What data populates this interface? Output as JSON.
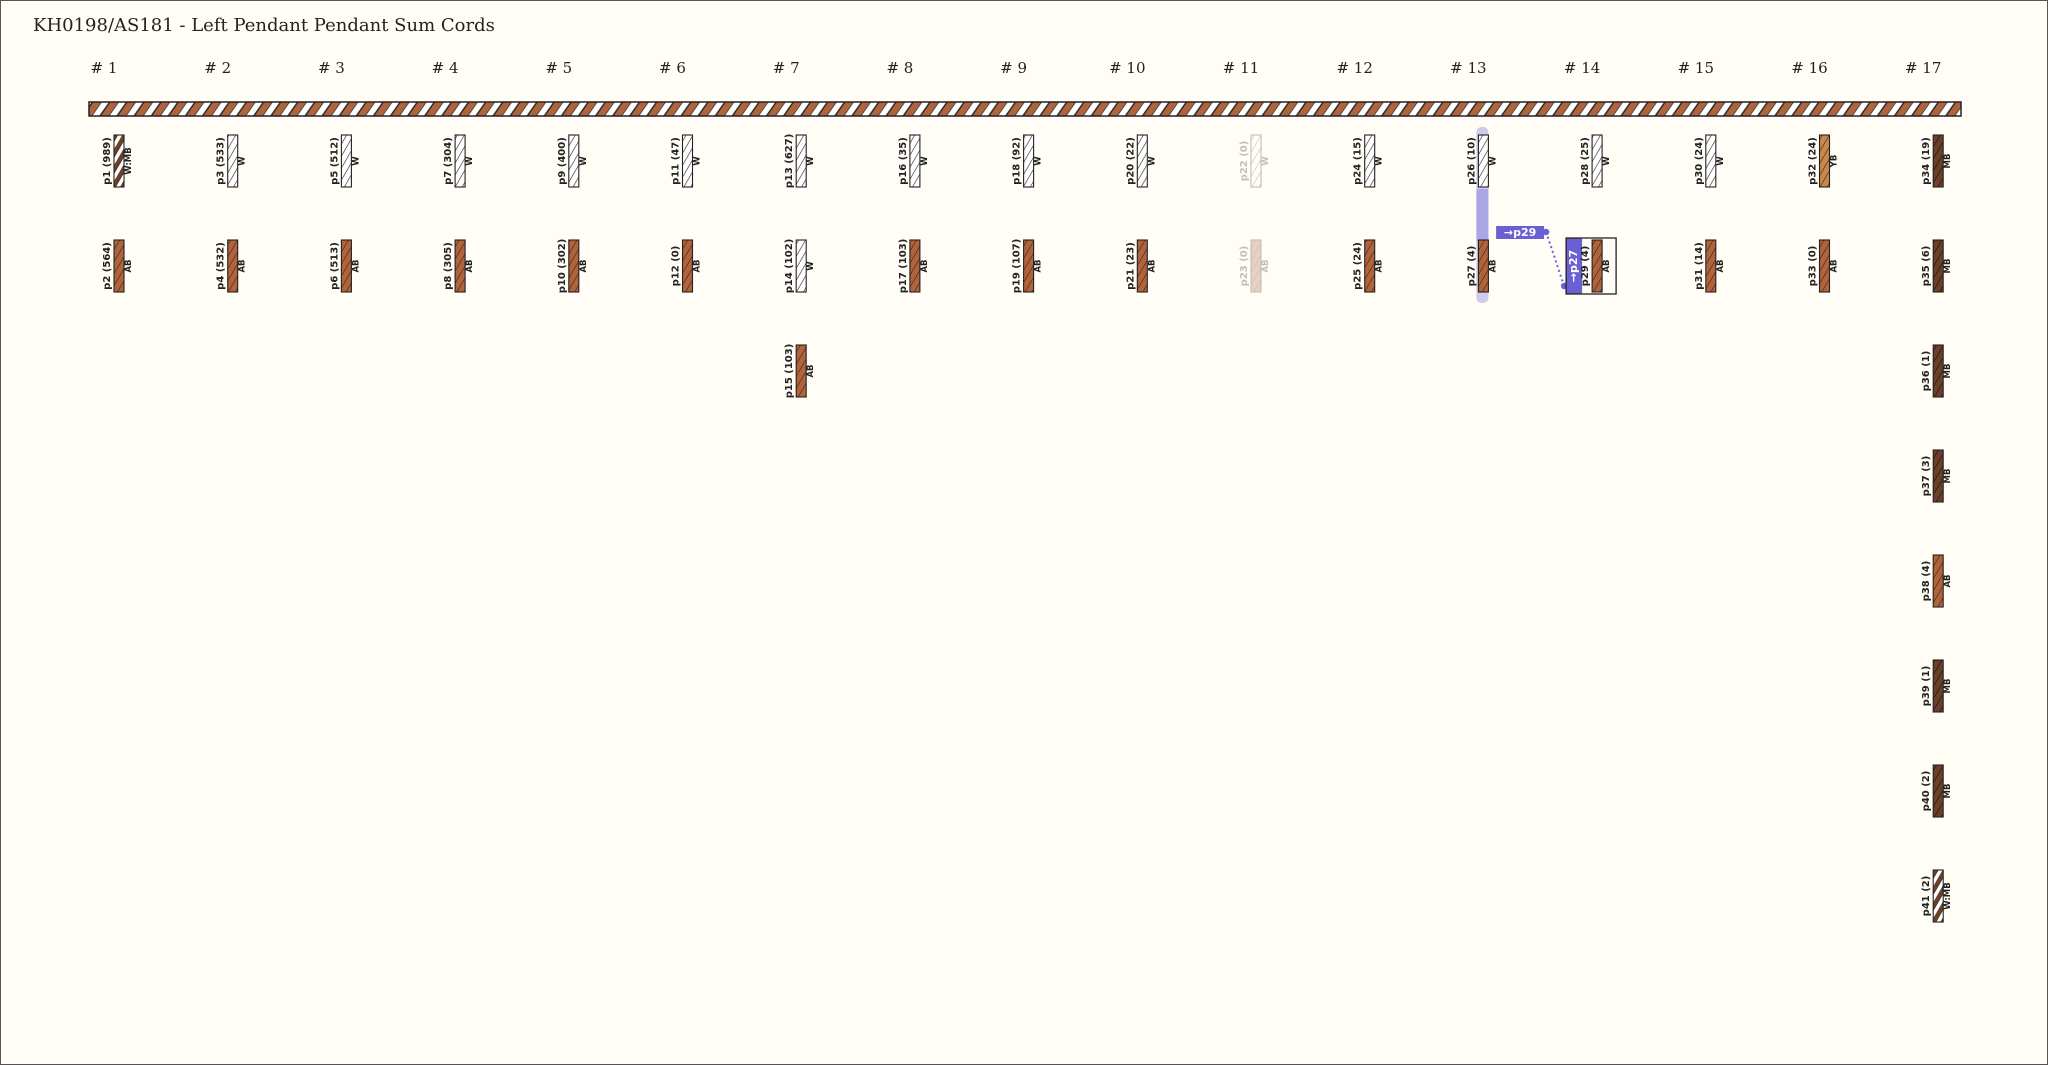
{
  "title": "KH0198/AS181 - Left Pendant Pendant Sum Cords",
  "colors": {
    "W": "#ffffff",
    "AB": "#b0643c",
    "MB": "#6b3f28",
    "YB": "#c88a4c",
    "link": "#6a60d4",
    "link_light": "#bdb9ec",
    "bg": "#fffdf6"
  },
  "groups": [
    "# 1",
    "# 2",
    "# 3",
    "# 4",
    "# 5",
    "# 6",
    "# 7",
    "# 8",
    "# 9",
    "# 10",
    "# 11",
    "# 12",
    "# 13",
    "# 14",
    "# 15",
    "# 16",
    "# 17"
  ],
  "cords": [
    {
      "group": 1,
      "row": 1,
      "label": "p1 (989)",
      "color": "W:MB"
    },
    {
      "group": 1,
      "row": 2,
      "label": "p2 (564)",
      "color": "AB"
    },
    {
      "group": 2,
      "row": 1,
      "label": "p3 (533)",
      "color": "W"
    },
    {
      "group": 2,
      "row": 2,
      "label": "p4 (532)",
      "color": "AB"
    },
    {
      "group": 3,
      "row": 1,
      "label": "p5 (512)",
      "color": "W"
    },
    {
      "group": 3,
      "row": 2,
      "label": "p6 (513)",
      "color": "AB"
    },
    {
      "group": 4,
      "row": 1,
      "label": "p7 (304)",
      "color": "W"
    },
    {
      "group": 4,
      "row": 2,
      "label": "p8 (305)",
      "color": "AB"
    },
    {
      "group": 5,
      "row": 1,
      "label": "p9 (400)",
      "color": "W"
    },
    {
      "group": 5,
      "row": 2,
      "label": "p10 (302)",
      "color": "AB"
    },
    {
      "group": 6,
      "row": 1,
      "label": "p11 (47)",
      "color": "W"
    },
    {
      "group": 6,
      "row": 2,
      "label": "p12 (0)",
      "color": "AB"
    },
    {
      "group": 7,
      "row": 1,
      "label": "p13 (627)",
      "color": "W"
    },
    {
      "group": 7,
      "row": 2,
      "label": "p14 (102)",
      "color": "W"
    },
    {
      "group": 7,
      "row": 3,
      "label": "p15 (103)",
      "color": "AB"
    },
    {
      "group": 8,
      "row": 1,
      "label": "p16 (35)",
      "color": "W"
    },
    {
      "group": 8,
      "row": 2,
      "label": "p17 (103)",
      "color": "AB"
    },
    {
      "group": 9,
      "row": 1,
      "label": "p18 (92)",
      "color": "W"
    },
    {
      "group": 9,
      "row": 2,
      "label": "p19 (107)",
      "color": "AB"
    },
    {
      "group": 10,
      "row": 1,
      "label": "p20 (22)",
      "color": "W"
    },
    {
      "group": 10,
      "row": 2,
      "label": "p21 (23)",
      "color": "AB"
    },
    {
      "group": 11,
      "row": 1,
      "label": "p22 (0)",
      "color": "W",
      "faded": true
    },
    {
      "group": 11,
      "row": 2,
      "label": "p23 (0)",
      "color": "AB",
      "faded": true
    },
    {
      "group": 12,
      "row": 1,
      "label": "p24 (15)",
      "color": "W"
    },
    {
      "group": 12,
      "row": 2,
      "label": "p25 (24)",
      "color": "AB"
    },
    {
      "group": 13,
      "row": 1,
      "label": "p26 (10)",
      "color": "W"
    },
    {
      "group": 13,
      "row": 2,
      "label": "p27 (4)",
      "color": "AB"
    },
    {
      "group": 14,
      "row": 1,
      "label": "p28 (25)",
      "color": "W"
    },
    {
      "group": 14,
      "row": 2,
      "label": "p29 (4)",
      "color": "AB"
    },
    {
      "group": 15,
      "row": 1,
      "label": "p30 (24)",
      "color": "W"
    },
    {
      "group": 15,
      "row": 2,
      "label": "p31 (14)",
      "color": "AB"
    },
    {
      "group": 16,
      "row": 1,
      "label": "p32 (24)",
      "color": "YB"
    },
    {
      "group": 16,
      "row": 2,
      "label": "p33 (0)",
      "color": "AB"
    },
    {
      "group": 17,
      "row": 1,
      "label": "p34 (19)",
      "color": "MB"
    },
    {
      "group": 17,
      "row": 2,
      "label": "p35 (6)",
      "color": "MB"
    },
    {
      "group": 17,
      "row": 3,
      "label": "p36 (1)",
      "color": "MB"
    },
    {
      "group": 17,
      "row": 4,
      "label": "p37 (3)",
      "color": "MB"
    },
    {
      "group": 17,
      "row": 5,
      "label": "p38 (4)",
      "color": "AB"
    },
    {
      "group": 17,
      "row": 6,
      "label": "p39 (1)",
      "color": "MB"
    },
    {
      "group": 17,
      "row": 7,
      "label": "p40 (2)",
      "color": "MB"
    },
    {
      "group": 17,
      "row": 8,
      "label": "p41 (2)",
      "color": "W:MB"
    }
  ],
  "sum_link": {
    "from_group": 14,
    "from_row": 2,
    "arrow_label": "→p29",
    "highlight_label": "→p27",
    "highlight_group": 13,
    "rows": [
      1,
      2
    ]
  }
}
